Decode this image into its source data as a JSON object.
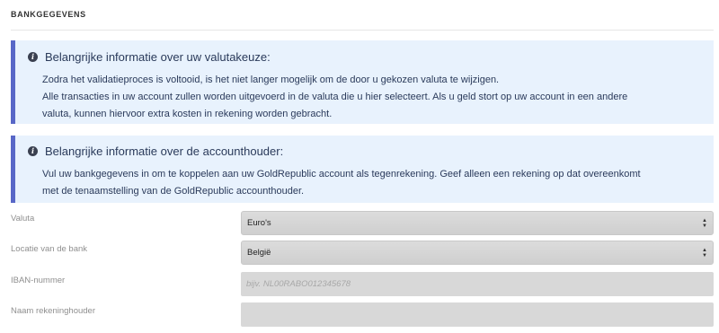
{
  "section": {
    "title": "BANKGEGEVENS"
  },
  "info_currency": {
    "heading": "Belangrijke informatie over uw valutakeuze:",
    "line1": "Zodra het validatieproces is voltooid, is het niet langer mogelijk om de door u gekozen valuta te wijzigen.",
    "line2": "Alle transacties in uw account zullen worden uitgevoerd in de valuta die u hier selecteert. Als u geld stort op uw account in een andere",
    "line3": "valuta, kunnen hiervoor extra kosten in rekening worden gebracht.",
    "icon": "info-circle-icon"
  },
  "info_holder": {
    "heading": "Belangrijke informatie over de accounthouder:",
    "line1": "Vul uw bankgegevens in om te koppelen aan uw GoldRepublic account als tegenrekening. Geef alleen een rekening op dat overeenkomt",
    "line2": "met de tenaamstelling van de GoldRepublic accounthouder.",
    "icon": "info-circle-icon"
  },
  "form": {
    "currency": {
      "label": "Valuta",
      "value": "Euro's"
    },
    "bank_location": {
      "label": "Locatie van de bank",
      "value": "België"
    },
    "iban": {
      "label": "IBAN-nummer",
      "value": "",
      "placeholder": "bijv. NL00RABO012345678"
    },
    "account_holder": {
      "label": "Naam rekeninghouder",
      "value": "",
      "placeholder": ""
    }
  },
  "colors": {
    "info_background": "#e8f2fd",
    "info_accent": "#5867c7"
  }
}
